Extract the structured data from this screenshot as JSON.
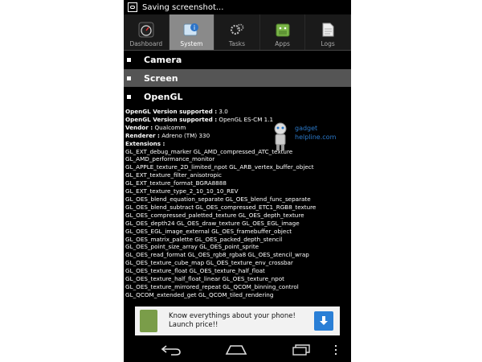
{
  "status_bar": {
    "text": "Saving screenshot..."
  },
  "tabs": [
    {
      "label": "Dashboard",
      "icon": "dashboard-gauge-icon"
    },
    {
      "label": "System",
      "icon": "system-info-icon",
      "active": true
    },
    {
      "label": "Tasks",
      "icon": "gears-icon"
    },
    {
      "label": "Apps",
      "icon": "android-icon"
    },
    {
      "label": "Logs",
      "icon": "document-icon"
    }
  ],
  "sections": [
    {
      "label": "Camera"
    },
    {
      "label": "Screen"
    },
    {
      "label": "OpenGL"
    }
  ],
  "opengl": {
    "version_label": "OpenGL Version supported :",
    "version_value": "3.0",
    "es_label": "OpenGL Version supported :",
    "es_value": "OpenGL ES-CM 1.1",
    "vendor_label": "Vendor :",
    "vendor_value": "Qualcomm",
    "renderer_label": "Renderer :",
    "renderer_value": "Adreno (TM) 330",
    "extensions_label": "Extensions :",
    "extensions": [
      "GL_EXT_debug_marker GL_AMD_compressed_ATC_texture",
      "GL_AMD_performance_monitor",
      "GL_APPLE_texture_2D_limited_npot GL_ARB_vertex_buffer_object",
      "GL_EXT_texture_filter_anisotropic",
      "GL_EXT_texture_format_BGRA8888",
      "GL_EXT_texture_type_2_10_10_10_REV",
      "GL_OES_blend_equation_separate GL_OES_blend_func_separate",
      "GL_OES_blend_subtract GL_OES_compressed_ETC1_RGB8_texture",
      "GL_OES_compressed_paletted_texture GL_OES_depth_texture",
      "GL_OES_depth24 GL_OES_draw_texture GL_OES_EGL_image",
      "GL_OES_EGL_image_external GL_OES_framebuffer_object",
      "GL_OES_matrix_palette GL_OES_packed_depth_stencil",
      "GL_OES_point_size_array GL_OES_point_sprite",
      "GL_OES_read_format GL_OES_rgb8_rgba8 GL_OES_stencil_wrap",
      "GL_OES_texture_cube_map GL_OES_texture_env_crossbar",
      "GL_OES_texture_float GL_OES_texture_half_float",
      "GL_OES_texture_half_float_linear GL_OES_texture_npot",
      "GL_OES_texture_mirrored_repeat GL_QCOM_binning_control",
      "GL_QCOM_extended_get GL_QCOM_tiled_rendering"
    ]
  },
  "watermark": {
    "line1": "gadget",
    "line2": "helpline.com"
  },
  "ad": {
    "line1": "Know everythings about your phone!",
    "line2": "Launch price!!"
  },
  "navbar": {
    "icons": [
      "back-icon",
      "home-icon",
      "recents-icon",
      "menu-icon"
    ]
  }
}
